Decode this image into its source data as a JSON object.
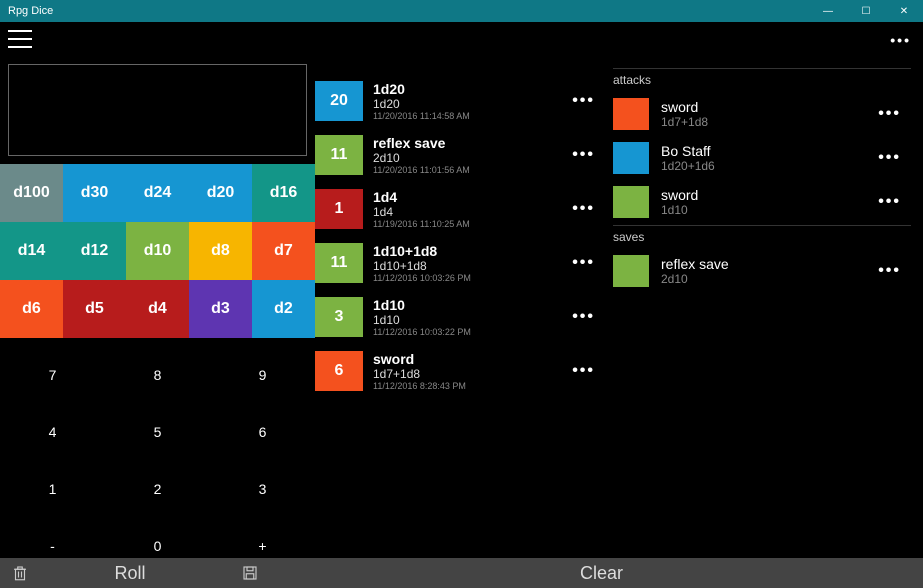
{
  "titlebar": {
    "title": "Rpg Dice"
  },
  "dice": [
    {
      "label": "d100",
      "color": "#6b8a8a"
    },
    {
      "label": "d30",
      "color": "#1696d2"
    },
    {
      "label": "d24",
      "color": "#1696d2"
    },
    {
      "label": "d20",
      "color": "#1696d2"
    },
    {
      "label": "d16",
      "color": "#139688"
    },
    {
      "label": "d14",
      "color": "#139688"
    },
    {
      "label": "d12",
      "color": "#139688"
    },
    {
      "label": "d10",
      "color": "#7cb342"
    },
    {
      "label": "d8",
      "color": "#f7b500"
    },
    {
      "label": "d7",
      "color": "#f4511e"
    },
    {
      "label": "d6",
      "color": "#f4511e"
    },
    {
      "label": "d5",
      "color": "#b71c1c"
    },
    {
      "label": "d4",
      "color": "#b71c1c"
    },
    {
      "label": "d3",
      "color": "#5e35b1"
    },
    {
      "label": "d2",
      "color": "#1696d2"
    }
  ],
  "numpad": [
    "7",
    "8",
    "9",
    "4",
    "5",
    "6",
    "1",
    "2",
    "3",
    "-",
    "0",
    "+"
  ],
  "rolls": [
    {
      "value": "20",
      "name": "1d20",
      "formula": "1d20",
      "time": "11/20/2016 11:14:58 AM",
      "color": "#1696d2"
    },
    {
      "value": "11",
      "name": "reflex save",
      "formula": "2d10",
      "time": "11/20/2016 11:01:56 AM",
      "color": "#7cb342"
    },
    {
      "value": "1",
      "name": "1d4",
      "formula": "1d4",
      "time": "11/19/2016 11:10:25 AM",
      "color": "#b71c1c"
    },
    {
      "value": "11",
      "name": "1d10+1d8",
      "formula": "1d10+1d8",
      "time": "11/12/2016 10:03:26 PM",
      "color": "#7cb342"
    },
    {
      "value": "3",
      "name": "1d10",
      "formula": "1d10",
      "time": "11/12/2016 10:03:22 PM",
      "color": "#7cb342"
    },
    {
      "value": "6",
      "name": "sword",
      "formula": "1d7+1d8",
      "time": "11/12/2016 8:28:43 PM",
      "color": "#f4511e"
    }
  ],
  "sections": {
    "attacks": {
      "title": "attacks",
      "items": [
        {
          "name": "sword",
          "formula": "1d7+1d8",
          "color": "#f4511e"
        },
        {
          "name": "Bo Staff",
          "formula": "1d20+1d6",
          "color": "#1696d2"
        },
        {
          "name": "sword",
          "formula": "1d10",
          "color": "#7cb342"
        }
      ]
    },
    "saves": {
      "title": "saves",
      "items": [
        {
          "name": "reflex save",
          "formula": "2d10",
          "color": "#7cb342"
        }
      ]
    }
  },
  "bottombar": {
    "roll": "Roll",
    "clear": "Clear"
  }
}
